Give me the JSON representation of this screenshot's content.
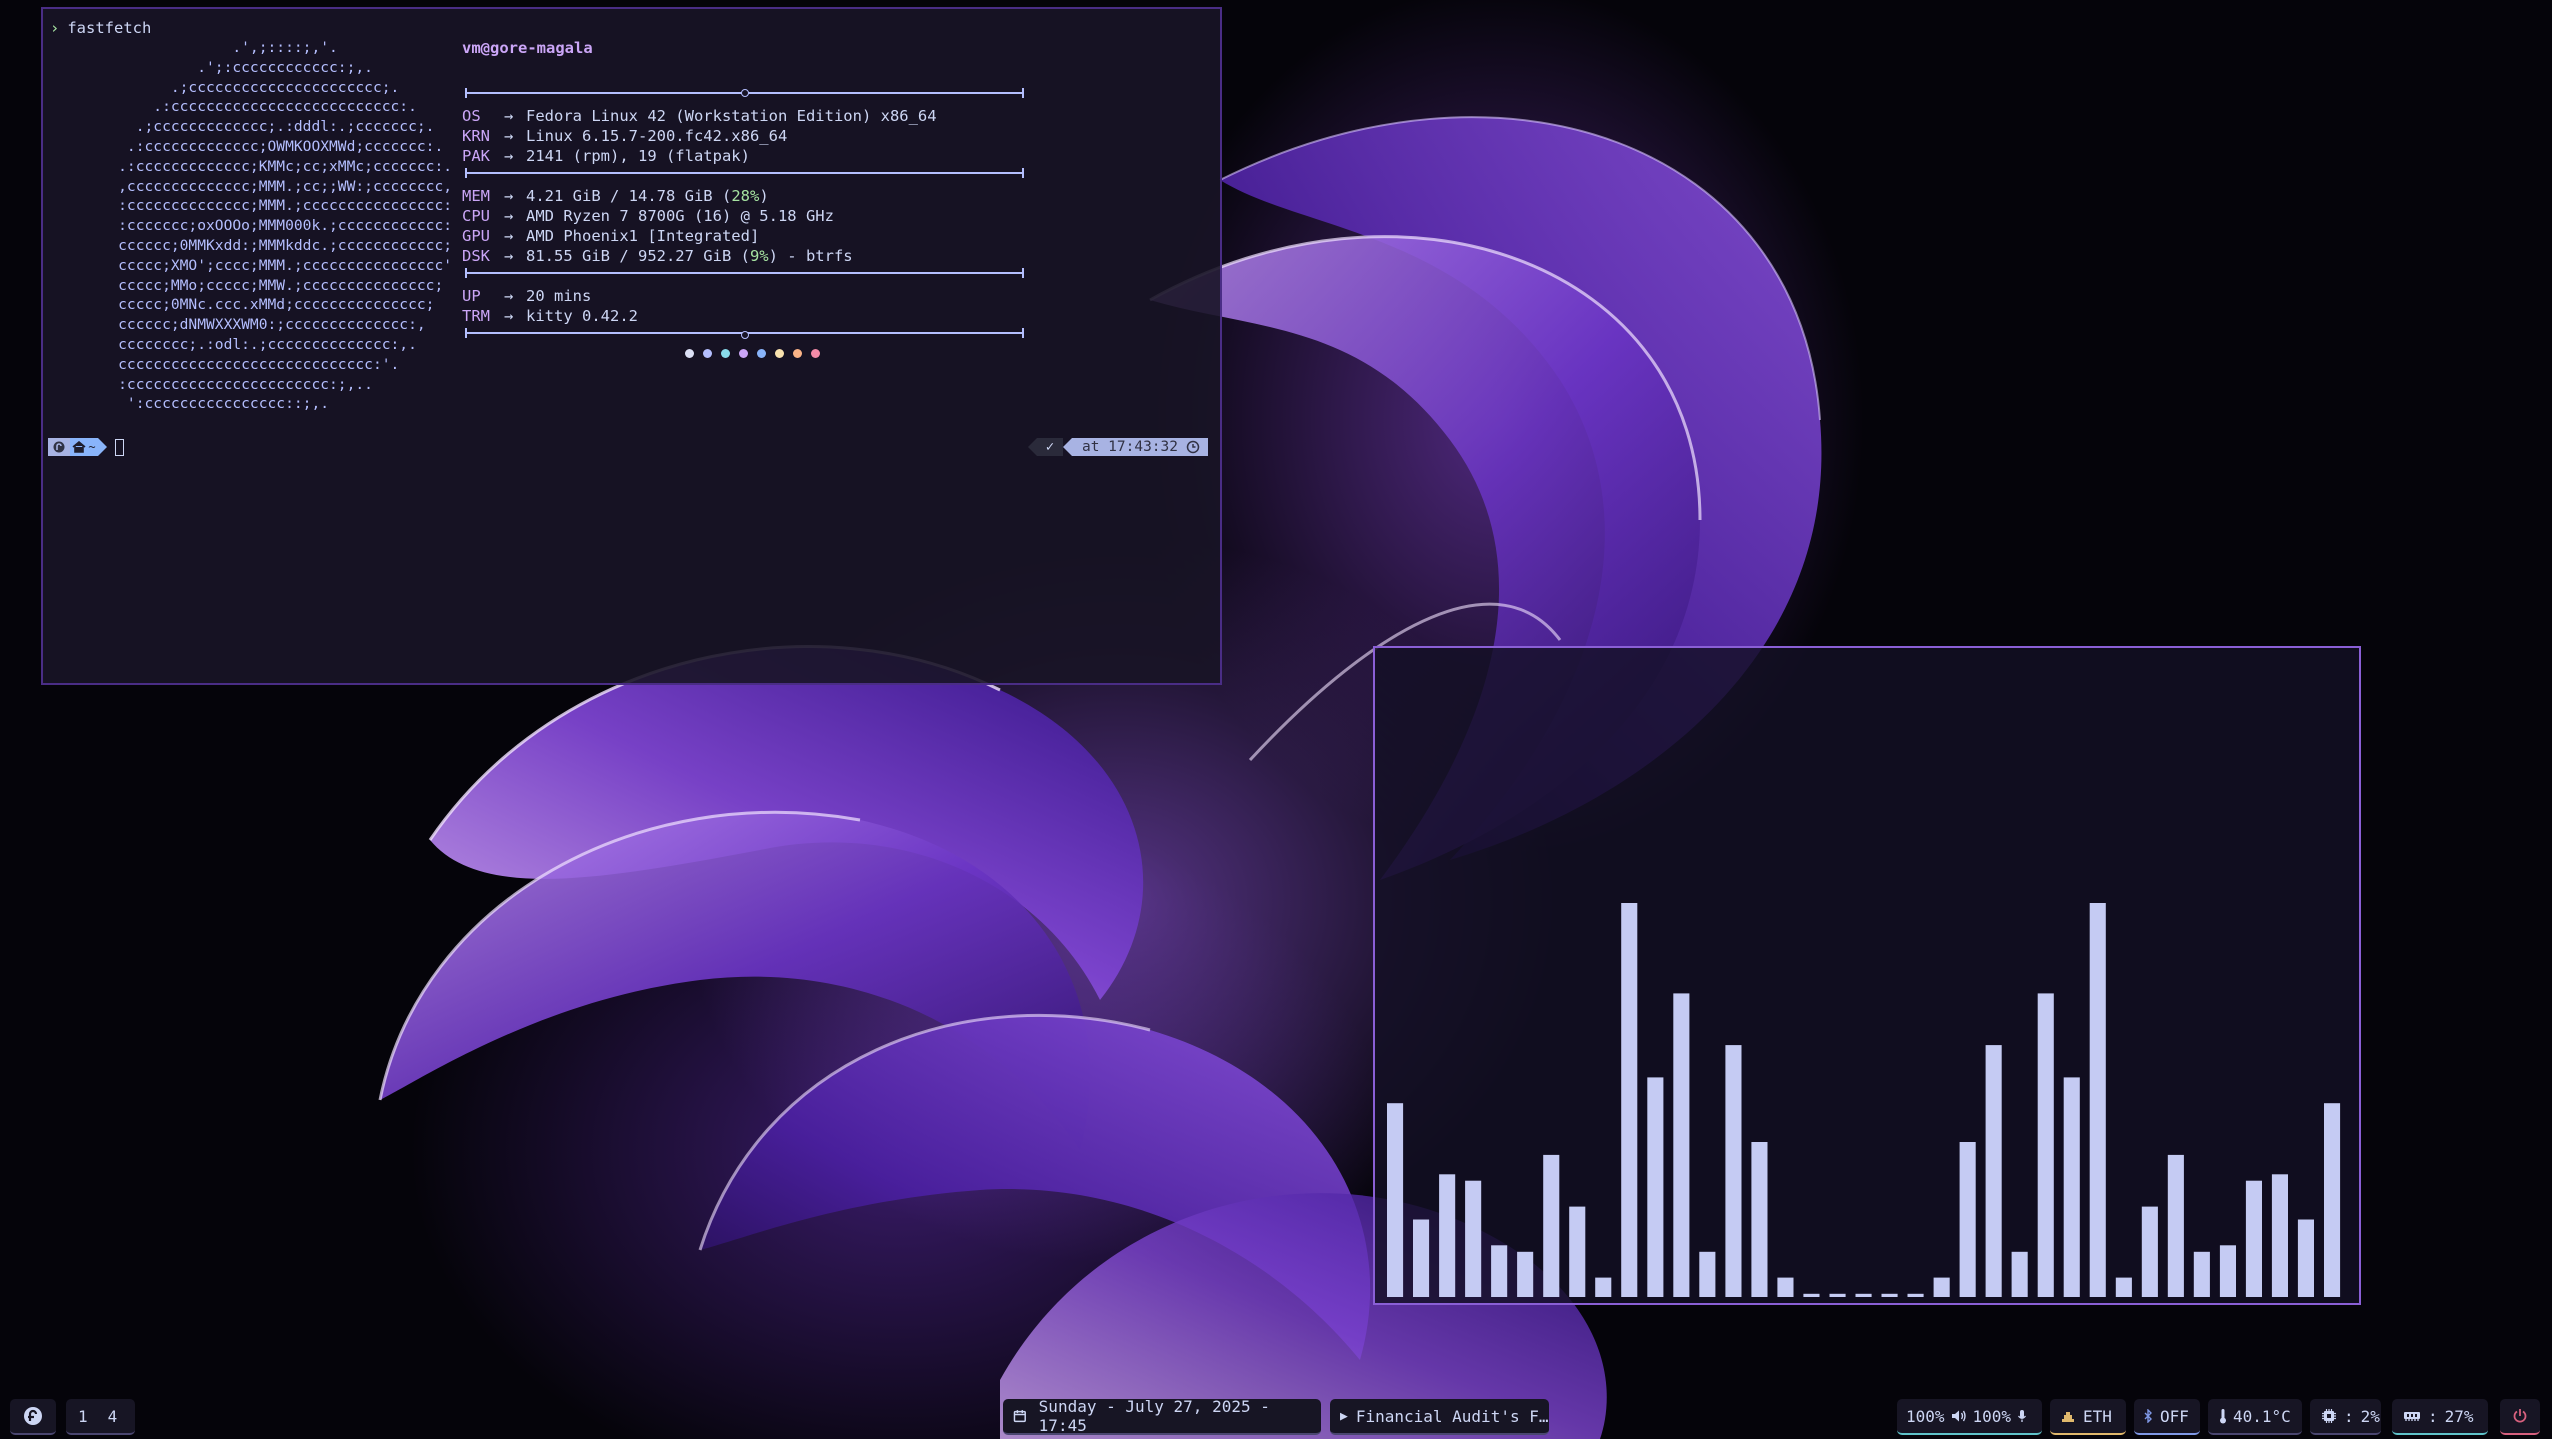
{
  "terminal": {
    "prompt_symbol": "›",
    "command": "fastfetch",
    "ascii_art": [
      "                 .',;::::;,'.",
      "             .';:cccccccccccc:;,.",
      "          .;cccccccccccccccccccccc;.",
      "        .:cccccccccccccccccccccccccc:.",
      "      .;ccccccccccccc;.:dddl:.;ccccccc;.",
      "     .:ccccccccccccc;OWMKOOXMWd;ccccccc:.",
      "    .:ccccccccccccc;KMMc;cc;xMMc;ccccccc:.",
      "    ,cccccccccccccc;MMM.;cc;;WW:;cccccccc,",
      "    :cccccccccccccc;MMM.;cccccccccccccccc:",
      "    :ccccccc;oxOOOo;MMM000k.;cccccccccccc:",
      "    cccccc;0MMKxdd:;MMMkddc.;cccccccccccc;",
      "    ccccc;XMO';cccc;MMM.;cccccccccccccccc'",
      "    ccccc;MMo;ccccc;MMW.;ccccccccccccccc;",
      "    ccccc;0MNc.ccc.xMMd;ccccccccccccccc;",
      "    cccccc;dNMWXXXWM0:;cccccccccccccc:,",
      "    cccccccc;.:odl:.;cccccccccccccc:,.",
      "    ccccccccccccccccccccccccccccc:'.",
      "    :ccccccccccccccccccccccc:;,..",
      "     ':cccccccccccccccc::;,."
    ],
    "host": "vm@gore-magala",
    "info": [
      {
        "key": "OS",
        "arrow": "→",
        "pre": "Fedora Linux 42 (Workstation Edition) x86_64",
        "hl": "",
        "post": ""
      },
      {
        "key": "KRN",
        "arrow": "→",
        "pre": "Linux 6.15.7-200.fc42.x86_64",
        "hl": "",
        "post": ""
      },
      {
        "key": "PAK",
        "arrow": "→",
        "pre": "2141 (rpm), 19 (flatpak)",
        "hl": "",
        "post": ""
      },
      {
        "key": "MEM",
        "arrow": "→",
        "pre": "4.21 GiB / 14.78 GiB (",
        "hl": "28%",
        "post": ")"
      },
      {
        "key": "CPU",
        "arrow": "→",
        "pre": "AMD Ryzen 7 8700G (16) @ 5.18 GHz",
        "hl": "",
        "post": ""
      },
      {
        "key": "GPU",
        "arrow": "→",
        "pre": "AMD Phoenix1 [Integrated]",
        "hl": "",
        "post": ""
      },
      {
        "key": "DSK",
        "arrow": "→",
        "pre": "81.55 GiB / 952.27 GiB (",
        "hl": "9%",
        "post": ") - btrfs"
      },
      {
        "key": "UP",
        "arrow": "→",
        "pre": "20 mins",
        "hl": "",
        "post": ""
      },
      {
        "key": "TRM",
        "arrow": "→",
        "pre": "kitty 0.42.2",
        "hl": "",
        "post": ""
      }
    ],
    "palette": [
      "#dce0f5",
      "#b4befe",
      "#89dceb",
      "#cba6f7",
      "#89b4fa",
      "#f9e2af",
      "#fab387",
      "#f38ba8"
    ],
    "prompt_status": {
      "check": "✓",
      "time": "at 17:43:32",
      "home": "~"
    },
    "colors": {
      "accent": "#cba6f7",
      "green": "#a6e3a1",
      "text": "#cdd6f4"
    }
  },
  "visualizer": {
    "bar_color": "#c5cbf3",
    "levels": [
      0.3,
      0.12,
      0.19,
      0.18,
      0.08,
      0.07,
      0.22,
      0.14,
      0.03,
      0.61,
      0.34,
      0.47,
      0.07,
      0.39,
      0.24,
      0.03,
      0.005,
      0.005,
      0.005,
      0.005,
      0.005,
      0.03,
      0.24,
      0.39,
      0.07,
      0.47,
      0.34,
      0.61,
      0.03,
      0.14,
      0.22,
      0.07,
      0.08,
      0.18,
      0.19,
      0.12,
      0.3
    ]
  },
  "taskbar": {
    "launcher_icon": "fedora-icon",
    "workspaces": [
      "1",
      "4"
    ],
    "clock": "Sunday - July 27, 2025 - 17:45",
    "media_play": "▶",
    "media_title": "Financial Audit's F…",
    "volume": "100%",
    "mic": "100%",
    "network": "ETH",
    "bluetooth": "OFF",
    "temperature": "40.1°C",
    "cpu_label": ":",
    "cpu": "2%",
    "mem_label": ":",
    "mem": "27%",
    "power_icon": "power-icon"
  }
}
